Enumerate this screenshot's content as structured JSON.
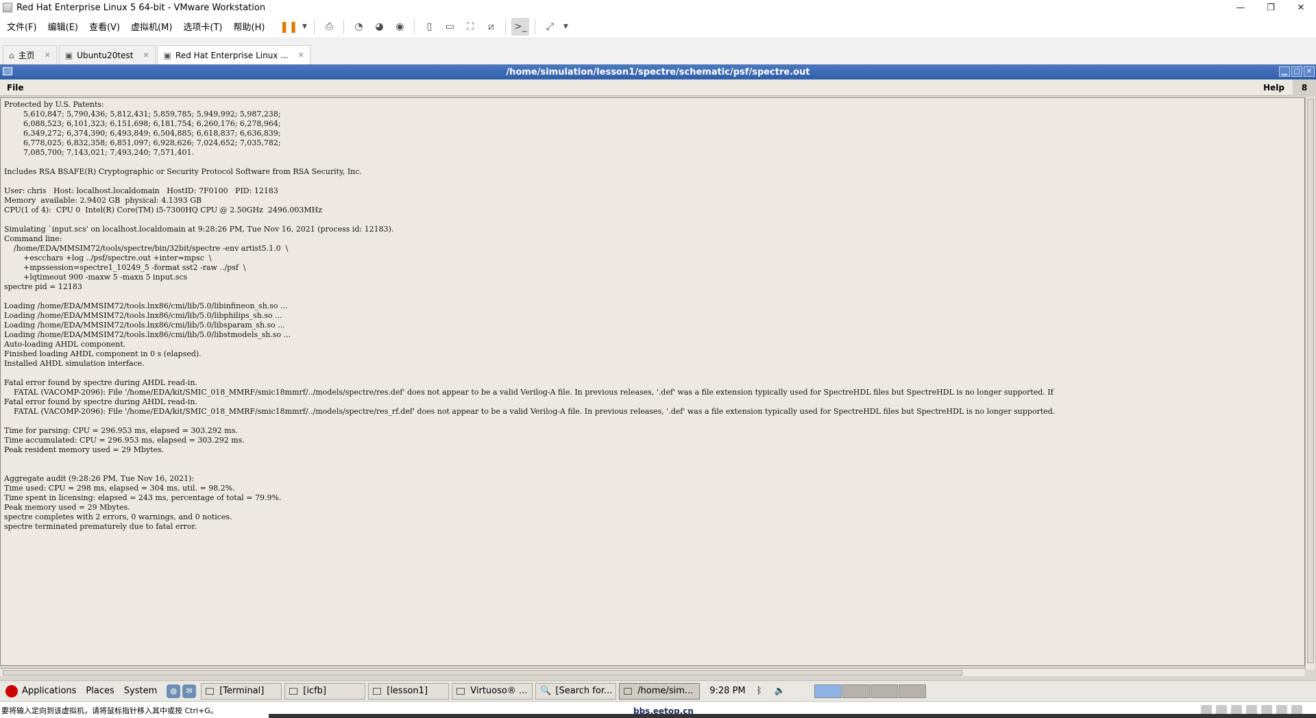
{
  "window": {
    "title": "Red Hat Enterprise Linux 5 64-bit - VMware Workstation",
    "controls": [
      "—",
      "❐",
      "✕"
    ]
  },
  "vmware_menu": [
    "文件(F)",
    "编辑(E)",
    "查看(V)",
    "虚拟机(M)",
    "选项卡(T)",
    "帮助(H)"
  ],
  "vmware_tabs": [
    {
      "label": "主页",
      "icon": "home-icon"
    },
    {
      "label": "Ubuntu20test",
      "icon": "vm-icon"
    },
    {
      "label": "Red Hat Enterprise Linux ...",
      "icon": "vm-icon"
    }
  ],
  "guest_window": {
    "title": "/home/simulation/lesson1/spectre/schematic/psf/spectre.out",
    "menu_file": "File",
    "menu_help": "Help",
    "menu_num": "8"
  },
  "log_lines": [
    "Protected by U.S. Patents:",
    "        5,610,847; 5,790,436; 5,812,431; 5,859,785; 5,949,992; 5,987,238;",
    "        6,088,523; 6,101,323; 6,151,698; 6,181,754; 6,260,176; 6,278,964;",
    "        6,349,272; 6,374,390; 6,493,849; 6,504,885; 6,618,837; 6,636,839;",
    "        6,778,025; 6,832,358; 6,851,097; 6,928,626; 7,024,652; 7,035,782;",
    "        7,085,700; 7,143,021; 7,493,240; 7,571,401.",
    "",
    "Includes RSA BSAFE(R) Cryptographic or Security Protocol Software from RSA Security, Inc.",
    "",
    "User: chris   Host: localhost.localdomain   HostID: 7F0100   PID: 12183",
    "Memory  available: 2.9402 GB  physical: 4.1393 GB",
    "CPU(1 of 4):  CPU 0  Intel(R) Core(TM) i5-7300HQ CPU @ 2.50GHz  2496.003MHz",
    "",
    "Simulating `input.scs' on localhost.localdomain at 9:28:26 PM, Tue Nov 16, 2021 (process id: 12183).",
    "Command line:",
    "    /home/EDA/MMSIM72/tools/spectre/bin/32bit/spectre -env artist5.1.0  \\",
    "        +escchars +log ../psf/spectre.out +inter=mpsc  \\",
    "        +mpssession=spectre1_10249_5 -format sst2 -raw ../psf  \\",
    "        +lqtimeout 900 -maxw 5 -maxn 5 input.scs",
    "spectre pid = 12183",
    "",
    "Loading /home/EDA/MMSIM72/tools.lnx86/cmi/lib/5.0/libinfineon_sh.so ...",
    "Loading /home/EDA/MMSIM72/tools.lnx86/cmi/lib/5.0/libphilips_sh.so ...",
    "Loading /home/EDA/MMSIM72/tools.lnx86/cmi/lib/5.0/libsparam_sh.so ...",
    "Loading /home/EDA/MMSIM72/tools.lnx86/cmi/lib/5.0/libstmodels_sh.so ...",
    "Auto-loading AHDL component.",
    "Finished loading AHDL component in 0 s (elapsed).",
    "Installed AHDL simulation interface.",
    "",
    "Fatal error found by spectre during AHDL read-in.",
    "    FATAL (VACOMP-2096): File '/home/EDA/kit/SMIC_018_MMRF/smic18mmrf/../models/spectre/res.def' does not appear to be a valid Verilog-A file. In previous releases, '.def' was a file extension typically used for SpectreHDL files but SpectreHDL is no longer supported. If",
    "Fatal error found by spectre during AHDL read-in.",
    "    FATAL (VACOMP-2096): File '/home/EDA/kit/SMIC_018_MMRF/smic18mmrf/../models/spectre/res_rf.def' does not appear to be a valid Verilog-A file. In previous releases, '.def' was a file extension typically used for SpectreHDL files but SpectreHDL is no longer supported.",
    "",
    "Time for parsing: CPU = 296.953 ms, elapsed = 303.292 ms.",
    "Time accumulated: CPU = 296.953 ms, elapsed = 303.292 ms.",
    "Peak resident memory used = 29 Mbytes.",
    "",
    "",
    "Aggregate audit (9:28:26 PM, Tue Nov 16, 2021):",
    "Time used: CPU = 298 ms, elapsed = 304 ms, util. = 98.2%.",
    "Time spent in licensing: elapsed = 243 ms, percentage of total = 79.9%.",
    "Peak memory used = 29 Mbytes.",
    "spectre completes with 2 errors, 0 warnings, and 0 notices.",
    "spectre terminated prematurely due to fatal error."
  ],
  "gnome_panel": {
    "menus": [
      "Applications",
      "Places",
      "System"
    ],
    "tasks": [
      "[Terminal]",
      "[icfb]",
      "[lesson1]",
      "Virtuoso® ...",
      "[Search for...",
      "/home/sim..."
    ],
    "clock": "9:28 PM"
  },
  "status": {
    "hint": "要将输入定向到该虚拟机，请将鼠标指针移入其中或按 Ctrl+G。",
    "watermark": "bbs.eetop.cn"
  }
}
